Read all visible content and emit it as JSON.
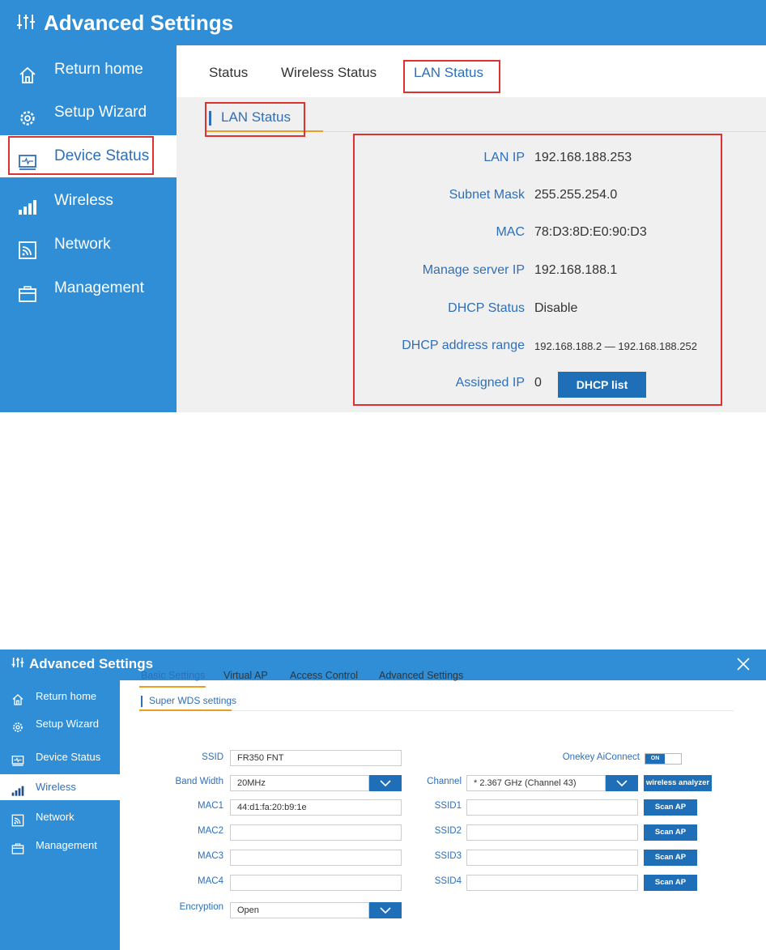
{
  "panel1": {
    "app_title": "Advanced Settings",
    "sidebar": [
      {
        "label": "Return home",
        "icon": "home-icon"
      },
      {
        "label": "Setup Wizard",
        "icon": "gear-icon"
      },
      {
        "label": "Device Status",
        "icon": "monitor-icon"
      },
      {
        "label": "Wireless",
        "icon": "signal-icon"
      },
      {
        "label": "Network",
        "icon": "network-icon"
      },
      {
        "label": "Management",
        "icon": "toolbox-icon"
      }
    ],
    "tabs": [
      "Status",
      "Wireless Status",
      "LAN Status"
    ],
    "section_title": "LAN Status",
    "fields": [
      {
        "label": "LAN IP",
        "value": "192.168.188.253"
      },
      {
        "label": "Subnet Mask",
        "value": "255.255.254.0"
      },
      {
        "label": "MAC",
        "value": "78:D3:8D:E0:90:D3"
      },
      {
        "label": "Manage server IP",
        "value": "192.168.188.1"
      },
      {
        "label": "DHCP Status",
        "value": "Disable"
      },
      {
        "label": "DHCP address range",
        "value": "192.168.188.2 — 192.168.188.252"
      },
      {
        "label": "Assigned IP",
        "value": "0"
      }
    ],
    "dhcp_list_button": "DHCP list"
  },
  "panel2": {
    "app_title": "Advanced Settings",
    "sidebar": [
      {
        "label": "Return home",
        "icon": "home-icon"
      },
      {
        "label": "Setup Wizard",
        "icon": "gear-icon"
      },
      {
        "label": "Device Status",
        "icon": "monitor-icon"
      },
      {
        "label": "Wireless",
        "icon": "signal-icon"
      },
      {
        "label": "Network",
        "icon": "network-icon"
      },
      {
        "label": "Management",
        "icon": "toolbox-icon"
      }
    ],
    "tabs": [
      "Basic Settings",
      "Virtual AP",
      "Access Control",
      "Advanced Settings"
    ],
    "section_title": "Super WDS settings",
    "ssid": {
      "label": "SSID",
      "value": "FR350 FNT"
    },
    "bandwidth": {
      "label": "Band Width",
      "value": "20MHz"
    },
    "mac": [
      {
        "label": "MAC1",
        "value": "44:d1:fa:20:b9:1e"
      },
      {
        "label": "MAC2",
        "value": ""
      },
      {
        "label": "MAC3",
        "value": ""
      },
      {
        "label": "MAC4",
        "value": ""
      }
    ],
    "encryption": {
      "label": "Encryption",
      "value": "Open"
    },
    "aiconnect": {
      "label": "Onekey AiConnect",
      "state": "ON"
    },
    "channel": {
      "label": "Channel",
      "value": "* 2.367 GHz (Channel 43)"
    },
    "wireless_analyzer_button": "wireless analyzer",
    "ssid_scan": [
      {
        "label": "SSID1",
        "value": "",
        "button": "Scan AP"
      },
      {
        "label": "SSID2",
        "value": "",
        "button": "Scan AP"
      },
      {
        "label": "SSID3",
        "value": "",
        "button": "Scan AP"
      },
      {
        "label": "SSID4",
        "value": "",
        "button": "Scan AP"
      }
    ]
  },
  "colors": {
    "brand_blue": "#2f8ed6",
    "button_blue": "#1f6fb8",
    "accent_orange": "#e8a020",
    "highlight_red": "#e03131"
  }
}
